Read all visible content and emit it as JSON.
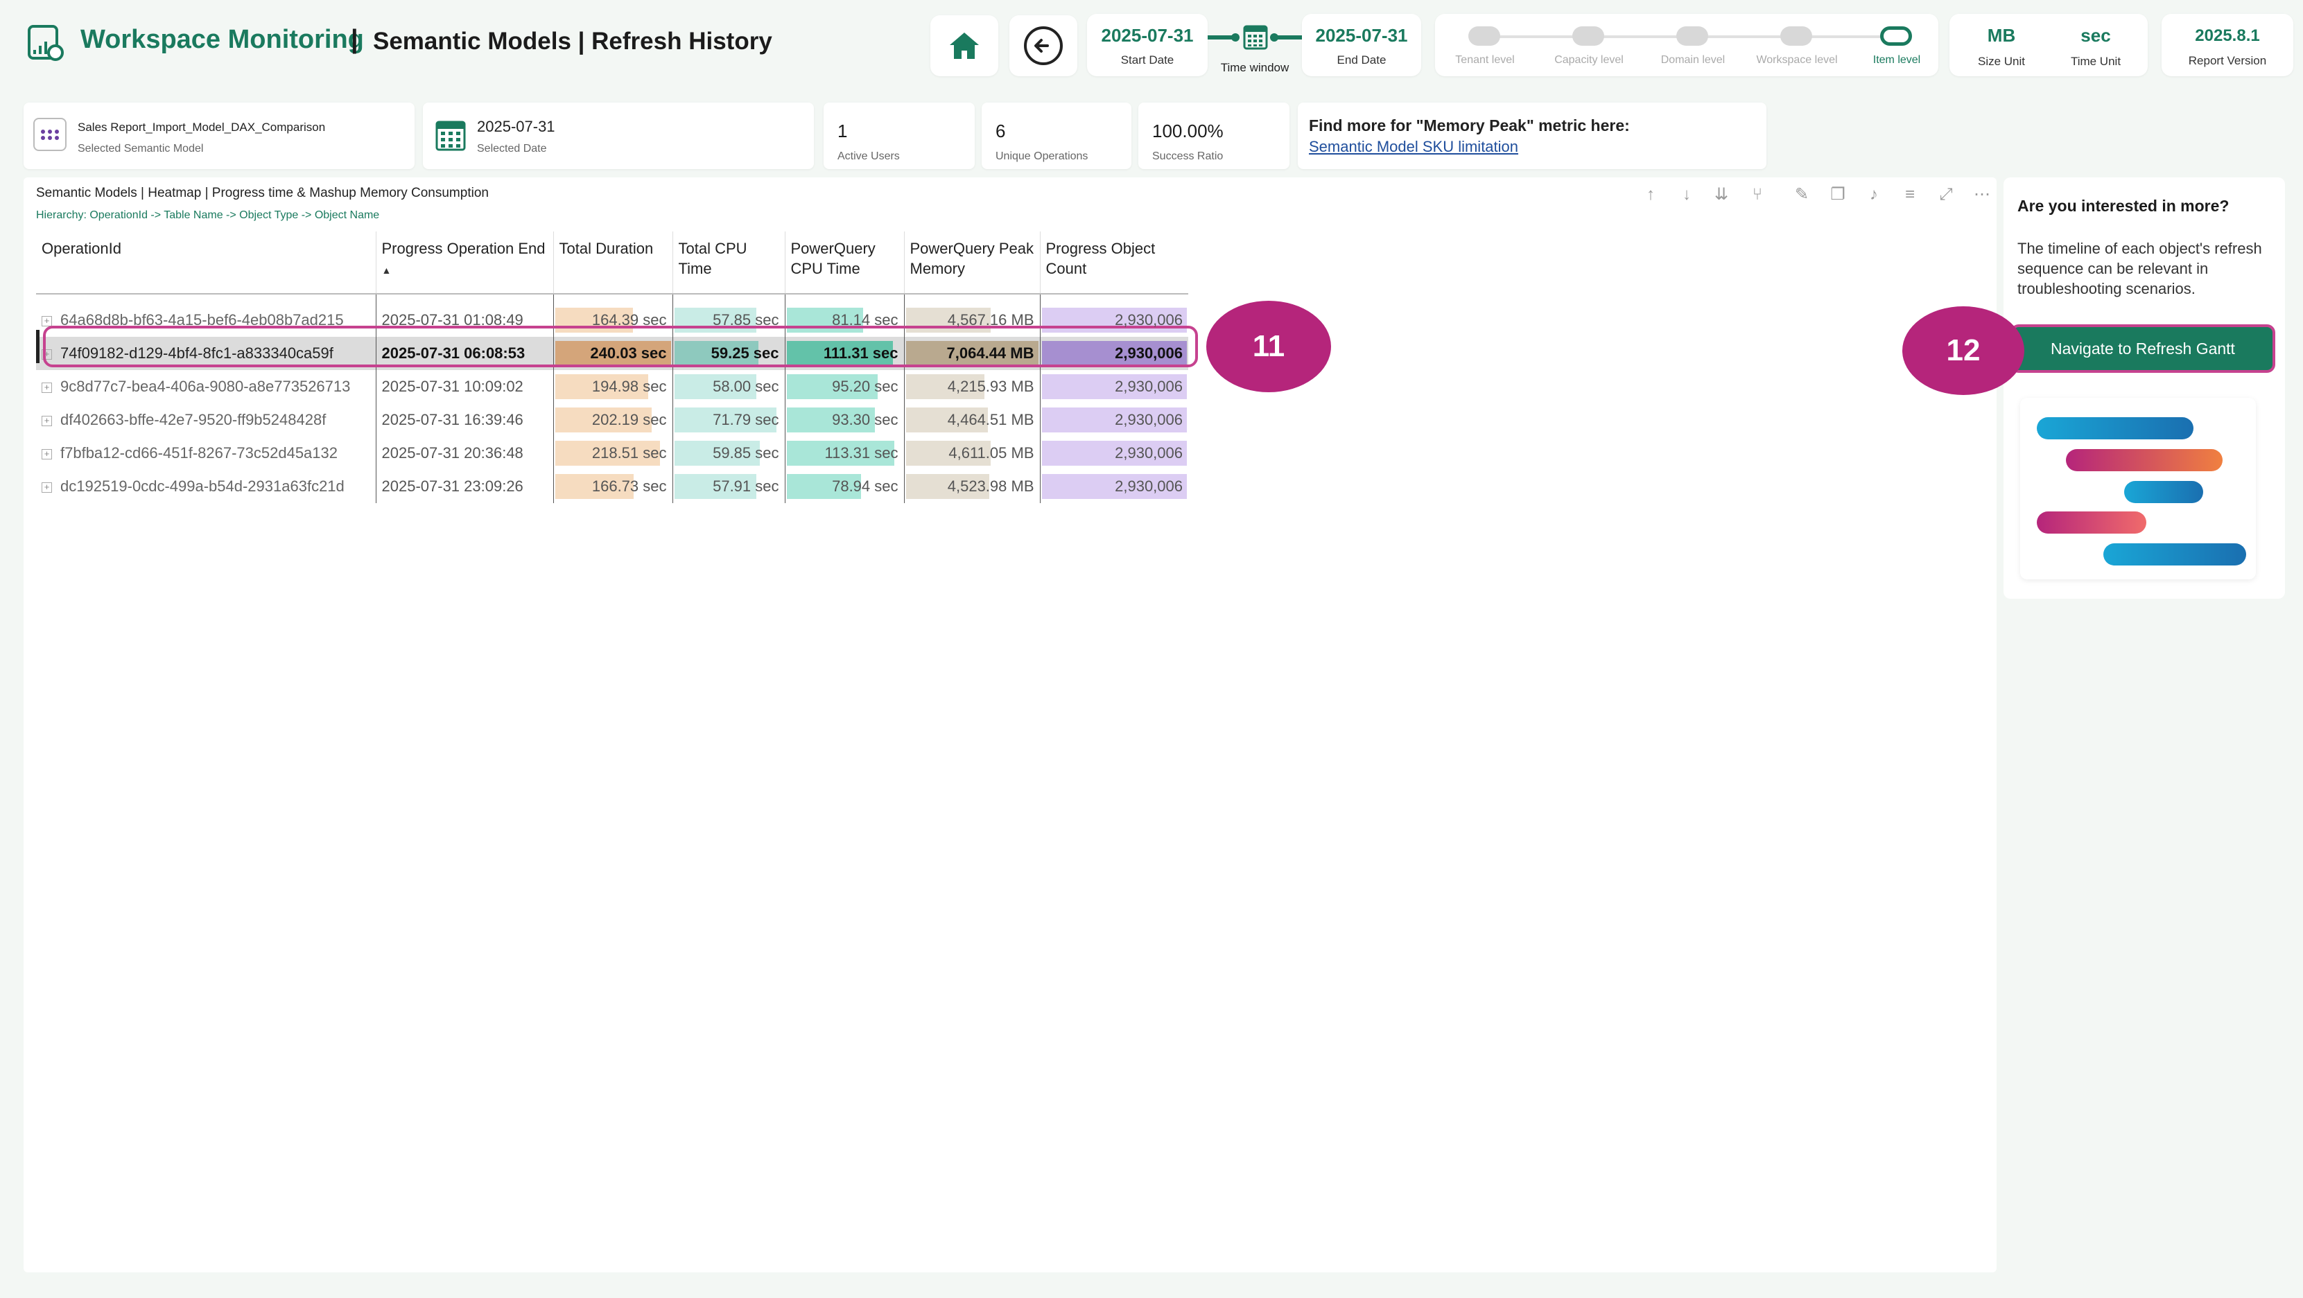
{
  "header": {
    "app_title": "Workspace Monitoring",
    "separator": "|",
    "page_title": "Semantic Models | Refresh History",
    "start_date": "2025-07-31",
    "start_date_label": "Start Date",
    "time_window_label": "Time window",
    "end_date": "2025-07-31",
    "end_date_label": "End Date",
    "levels": [
      "Tenant level",
      "Capacity level",
      "Domain level",
      "Workspace level",
      "Item level"
    ],
    "active_level": "Item level",
    "size_unit": "MB",
    "size_unit_label": "Size Unit",
    "time_unit": "sec",
    "time_unit_label": "Time Unit",
    "report_version": "2025.8.1",
    "report_version_label": "Report Version"
  },
  "kpis": {
    "semantic_model": "Sales Report_Import_Model_DAX_Comparison",
    "semantic_model_label": "Selected Semantic Model",
    "selected_date": "2025-07-31",
    "selected_date_label": "Selected Date",
    "active_users": "1",
    "active_users_label": "Active Users",
    "unique_operations": "6",
    "unique_operations_label": "Unique Operations",
    "success_ratio": "100.00%",
    "success_ratio_label": "Success Ratio",
    "memory_peak_title": "Find more for \"Memory Peak\" metric here:",
    "memory_peak_link": "Semantic Model SKU limitation"
  },
  "heatmap": {
    "title": "Semantic Models | Heatmap | Progress time & Mashup Memory Consumption",
    "hierarchy": "Hierarchy: OperationId -> Table Name -> Object Type -> Object Name",
    "columns": {
      "operation_id": "OperationId",
      "progress_end": "Progress Operation End",
      "total_duration": "Total Duration",
      "total_cpu": "Total CPU Time",
      "pq_cpu": "PowerQuery CPU Time",
      "pq_peak_memory": "PowerQuery Peak Memory",
      "progress_object_count": "Progress Object Count"
    },
    "rows": [
      {
        "operation_id": "64a68d8b-bf63-4a15-bef6-4eb08b7ad215",
        "progress_end": "2025-07-31 01:08:49",
        "total_duration": "164.39 sec",
        "total_cpu": "57.85 sec",
        "pq_cpu": "81.14 sec",
        "pq_peak_memory": "4,567.16 MB",
        "progress_object_count": "2,930,006"
      },
      {
        "operation_id": "74f09182-d129-4bf4-8fc1-a833340ca59f",
        "progress_end": "2025-07-31 06:08:53",
        "total_duration": "240.03 sec",
        "total_cpu": "59.25 sec",
        "pq_cpu": "111.31 sec",
        "pq_peak_memory": "7,064.44 MB",
        "progress_object_count": "2,930,006"
      },
      {
        "operation_id": "9c8d77c7-bea4-406a-9080-a8e773526713",
        "progress_end": "2025-07-31 10:09:02",
        "total_duration": "194.98 sec",
        "total_cpu": "58.00 sec",
        "pq_cpu": "95.20 sec",
        "pq_peak_memory": "4,215.93 MB",
        "progress_object_count": "2,930,006"
      },
      {
        "operation_id": "df402663-bffe-42e7-9520-ff9b5248428f",
        "progress_end": "2025-07-31 16:39:46",
        "total_duration": "202.19 sec",
        "total_cpu": "71.79 sec",
        "pq_cpu": "93.30 sec",
        "pq_peak_memory": "4,464.51 MB",
        "progress_object_count": "2,930,006"
      },
      {
        "operation_id": "f7bfba12-cd66-451f-8267-73c52d45a132",
        "progress_end": "2025-07-31 20:36:48",
        "total_duration": "218.51 sec",
        "total_cpu": "59.85 sec",
        "pq_cpu": "113.31 sec",
        "pq_peak_memory": "4,611.05 MB",
        "progress_object_count": "2,930,006"
      },
      {
        "operation_id": "dc192519-0cdc-499a-b54d-2931a63fc21d",
        "progress_end": "2025-07-31 23:09:26",
        "total_duration": "166.73 sec",
        "total_cpu": "57.91 sec",
        "pq_cpu": "78.94 sec",
        "pq_peak_memory": "4,523.98 MB",
        "progress_object_count": "2,930,006"
      }
    ],
    "bar_fractions": {
      "total_duration": [
        0.68,
        1.0,
        0.81,
        0.84,
        0.91,
        0.69
      ],
      "total_cpu": [
        0.76,
        0.78,
        0.76,
        0.94,
        0.79,
        0.76
      ],
      "pq_cpu": [
        0.67,
        0.92,
        0.79,
        0.77,
        0.93,
        0.65
      ],
      "pq_peak_memory": [
        0.65,
        1.0,
        0.6,
        0.63,
        0.65,
        0.64
      ],
      "progress_object_count": [
        1.0,
        1.0,
        1.0,
        1.0,
        1.0,
        1.0
      ]
    },
    "selected_row": 1
  },
  "callouts": {
    "badge_11": "11",
    "badge_12": "12"
  },
  "side": {
    "title": "Are you interested in more?",
    "text": "The timeline of each object's refresh sequence can be relevant in troubleshooting scenarios.",
    "nav_button": "Navigate to Refresh Gantt"
  },
  "colors": {
    "brand": "#1a7a5e",
    "callout": "#b5257b",
    "duration": "#f6dcc0",
    "cpu": "#c9ece6",
    "pq_cpu": "#a9e6d8",
    "memory": "#e5dfd3",
    "count": "#dccdf3"
  }
}
